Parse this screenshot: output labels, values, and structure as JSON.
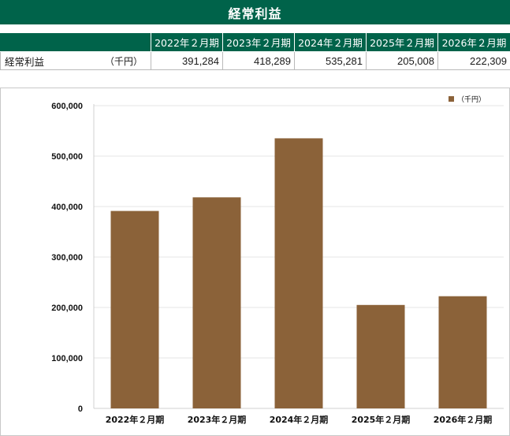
{
  "title": "経常利益",
  "table": {
    "headers": [
      "2022年２月期",
      "2023年２月期",
      "2024年２月期",
      "2025年２月期",
      "2026年２月期"
    ],
    "row_label": "経常利益",
    "row_unit": "（千円）",
    "values": [
      "391,284",
      "418,289",
      "535,281",
      "205,008",
      "222,309"
    ]
  },
  "colors": {
    "header_bg": "#00634a",
    "bar": "#8b6239"
  },
  "chart_data": {
    "type": "bar",
    "categories": [
      "2022年２月期",
      "2023年２月期",
      "2024年２月期",
      "2025年２月期",
      "2026年２月期"
    ],
    "series": [
      {
        "name": "（千円）",
        "values": [
          391284,
          418289,
          535281,
          205008,
          222309
        ]
      }
    ],
    "ylim": [
      0,
      600000
    ],
    "yticks": [
      "0",
      "100,000",
      "200,000",
      "300,000",
      "400,000",
      "500,000",
      "600,000"
    ],
    "legend": "top-right",
    "grid": true
  }
}
